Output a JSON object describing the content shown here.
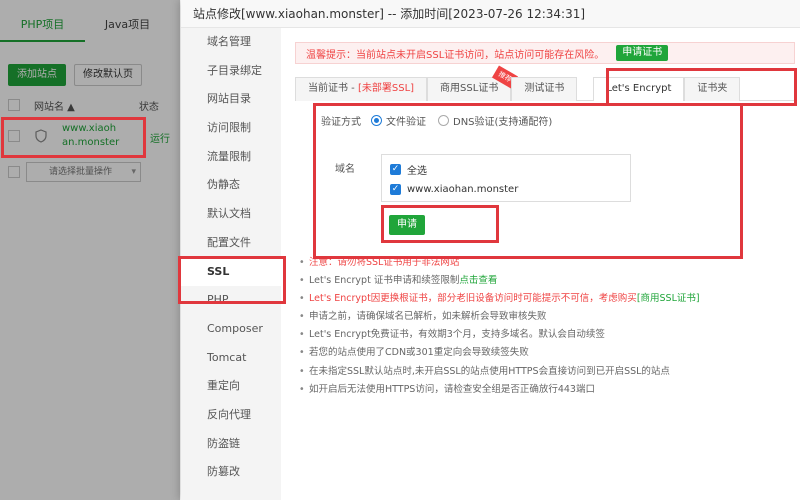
{
  "background": {
    "tabs": [
      "PHP项目",
      "Java项目"
    ],
    "toolbar": [
      "添加站点",
      "修改默认页"
    ],
    "table_headers": [
      "网站名 ▲",
      "状态"
    ],
    "site_line1": "www.xiaoh",
    "site_line2": "an.monster",
    "status": "运行",
    "batch_placeholder": "请选择批量操作"
  },
  "modal": {
    "title": "站点修改[www.xiaohan.monster] -- 添加时间[2023-07-26 12:34:31]",
    "menu": [
      "域名管理",
      "子目录绑定",
      "网站目录",
      "访问限制",
      "流量限制",
      "伪静态",
      "默认文档",
      "配置文件",
      "SSL",
      "PHP",
      "Composer",
      "Tomcat",
      "重定向",
      "反向代理",
      "防盗链",
      "防篡改"
    ],
    "warning": "温馨提示：当前站点未开启SSL证书访问，站点访问可能存在风险。",
    "warning_button": "申请证书",
    "ssl_tabs": {
      "current_prefix": "当前证书 - ",
      "current_status": "[未部署SSL]",
      "commercial": "商用SSL证书",
      "ribbon": "推荐",
      "test": "测试证书",
      "letsencrypt": "Let's Encrypt",
      "folder": "证书夹"
    },
    "verify_label": "验证方式",
    "verify_options": [
      "文件验证",
      "DNS验证(支持通配符)"
    ],
    "domain_label": "域名",
    "domains": [
      "全选",
      "www.xiaohan.monster"
    ],
    "apply_button": "申请",
    "notes": {
      "n1": "注意：请勿将SSL证书用于非法网站",
      "n2_pre": "Let's Encrypt 证书申请和续签限制 ",
      "n2_link": "点击查看",
      "n3_pre": "Let's Encrypt因更换根证书，部分老旧设备访问时可能提示不可信，考虑购买",
      "n3_link": "[商用SSL证书]",
      "n4": "申请之前，请确保域名已解析，如未解析会导致审核失败",
      "n5": "Let's Encrypt免费证书，有效期3个月，支持多域名。默认会自动续签",
      "n6": "若您的站点使用了CDN或301重定向会导致续签失败",
      "n7": "在未指定SSL默认站点时,未开启SSL的站点使用HTTPS会直接访问到已开启SSL的站点",
      "n8": "如开启后无法使用HTTPS访问，请检查安全组是否正确放行443端口"
    }
  },
  "colors": {
    "accent": "#20a53a",
    "alert": "#ef4444",
    "highlight_box": "#e0373d",
    "check": "#1e7bd8"
  }
}
